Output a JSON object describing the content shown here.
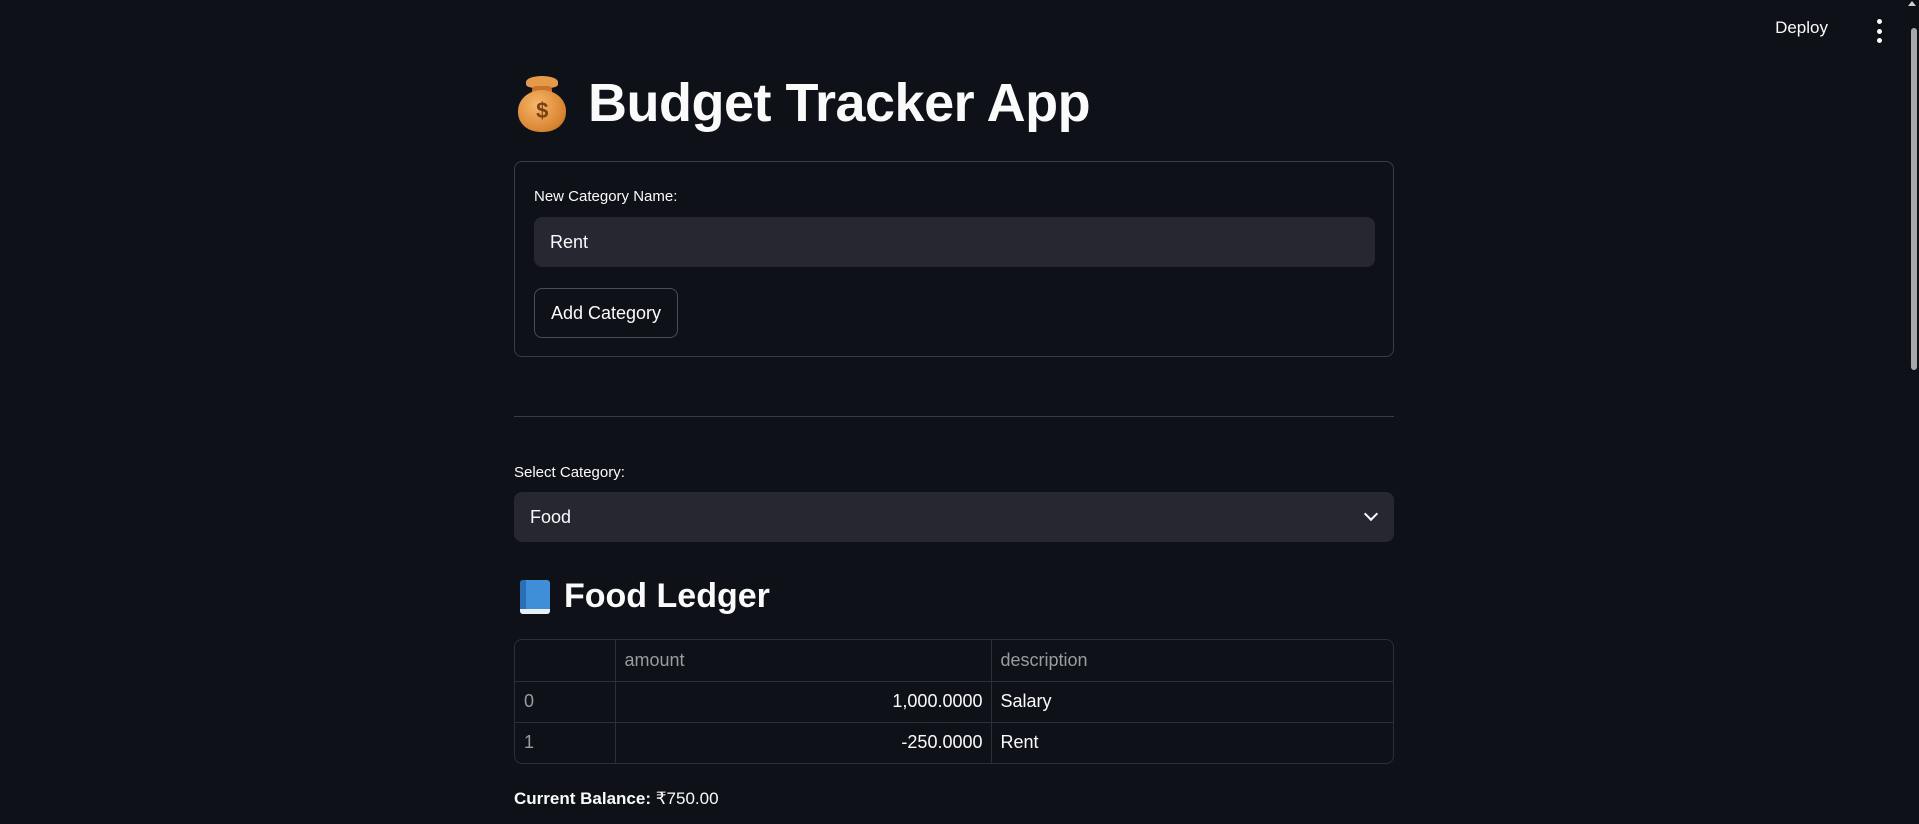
{
  "header": {
    "deploy_label": "Deploy",
    "menu_icon": "kebab-menu-icon"
  },
  "app": {
    "title": "Budget Tracker App",
    "title_icon": "money-bag-icon"
  },
  "new_category": {
    "label": "New Category Name:",
    "value": "Rent",
    "button_label": "Add Category"
  },
  "select_category": {
    "label": "Select Category:",
    "selected": "Food",
    "icon": "chevron-down-icon"
  },
  "ledger": {
    "heading": "Food Ledger",
    "icon": "blue-book-icon",
    "columns": [
      "",
      "amount",
      "description"
    ],
    "rows": [
      {
        "index": "0",
        "amount": "1,000.0000",
        "description": "Salary"
      },
      {
        "index": "1",
        "amount": "-250.0000",
        "description": "Rent"
      }
    ]
  },
  "balance": {
    "label": "Current Balance:",
    "value": "₹750.00"
  }
}
